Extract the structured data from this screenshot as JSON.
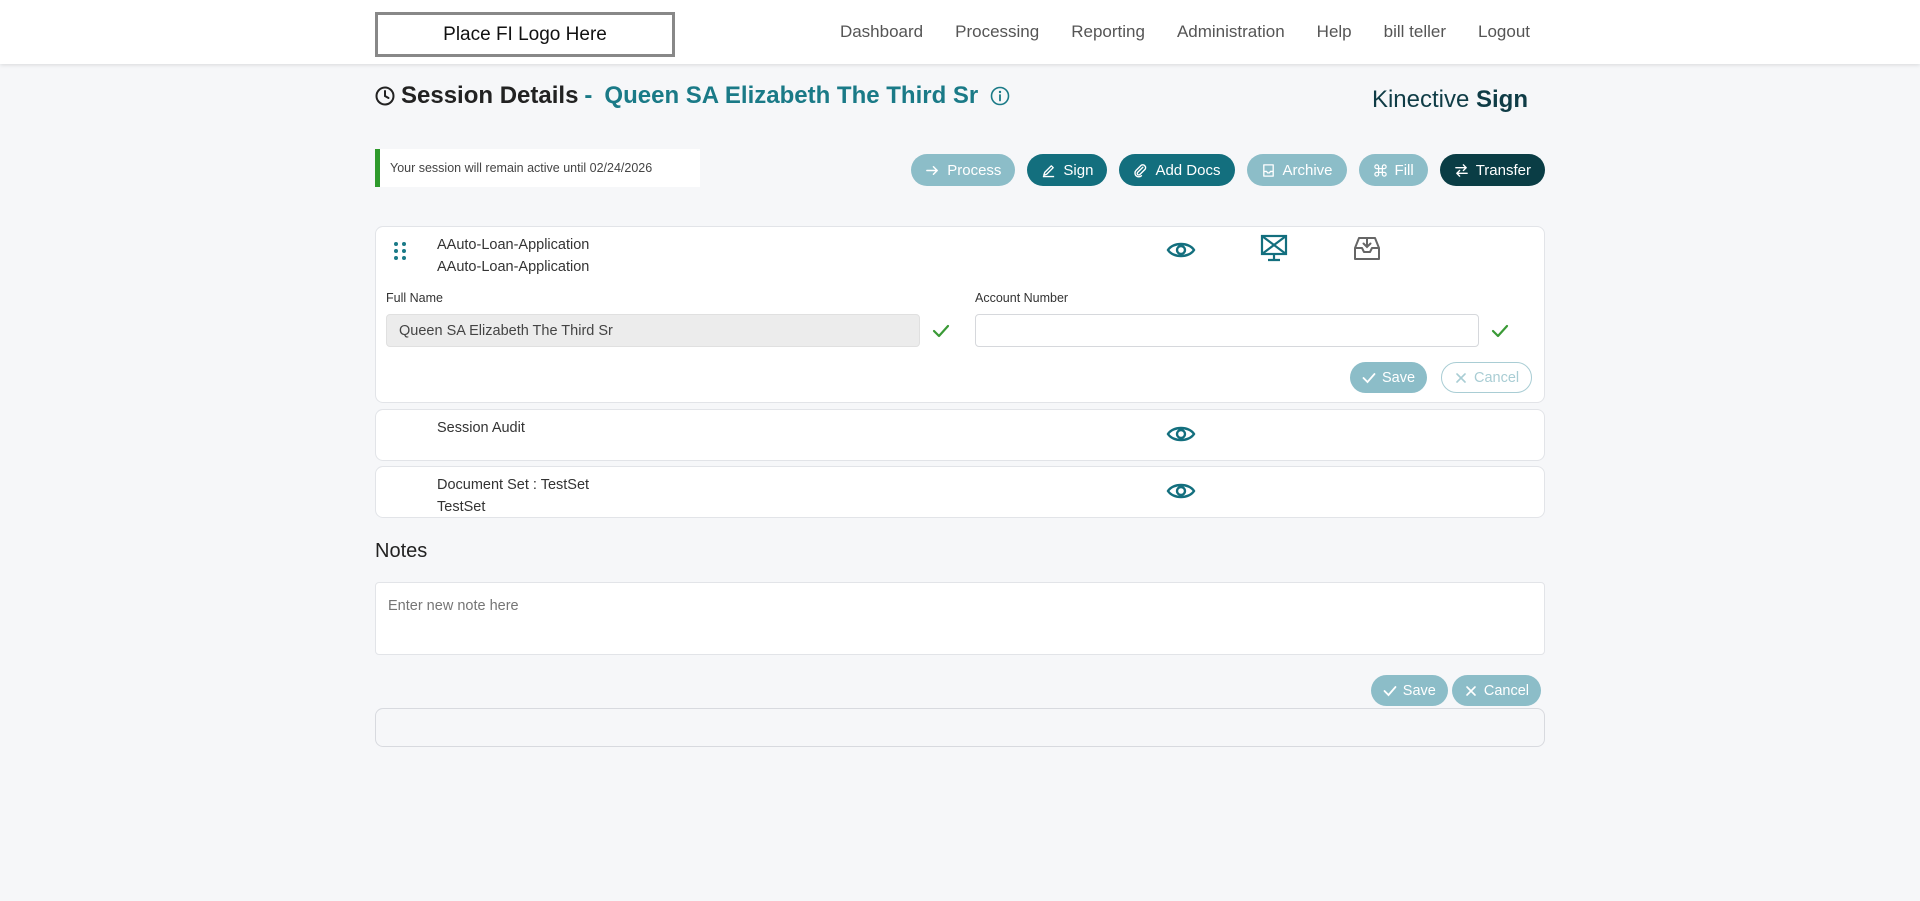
{
  "nav": {
    "logo": "Place FI Logo Here",
    "items": [
      "Dashboard",
      "Processing",
      "Reporting",
      "Administration",
      "Help",
      "bill teller",
      "Logout"
    ]
  },
  "header": {
    "title": "Session Details",
    "separator": "-",
    "customer": "Queen SA Elizabeth The Third Sr",
    "brand_light": "Kinective ",
    "brand_bold": "Sign"
  },
  "banner": {
    "text": "Your session will remain active until 02/24/2026"
  },
  "actions": {
    "process": "Process",
    "sign": "Sign",
    "add_docs": "Add Docs",
    "archive": "Archive",
    "fill": "Fill",
    "transfer": "Transfer"
  },
  "documents": [
    {
      "line1": "AAuto-Loan-Application",
      "line2": "AAuto-Loan-Application"
    },
    {
      "line1": "Session Audit",
      "line2": ""
    },
    {
      "line1": "Document Set : TestSet",
      "line2": "TestSet"
    }
  ],
  "form": {
    "full_name_label": "Full Name",
    "full_name_value": "Queen SA Elizabeth The Third Sr",
    "account_number_label": "Account Number",
    "account_number_value": "",
    "save": "Save",
    "cancel": "Cancel"
  },
  "notes": {
    "title": "Notes",
    "placeholder": "Enter new note here",
    "save": "Save",
    "cancel": "Cancel"
  },
  "colors": {
    "teal": "#1a7a87",
    "teal_dark": "#0a3d45",
    "teal_light": "#8cbdc8",
    "success": "#2e9a2c"
  }
}
